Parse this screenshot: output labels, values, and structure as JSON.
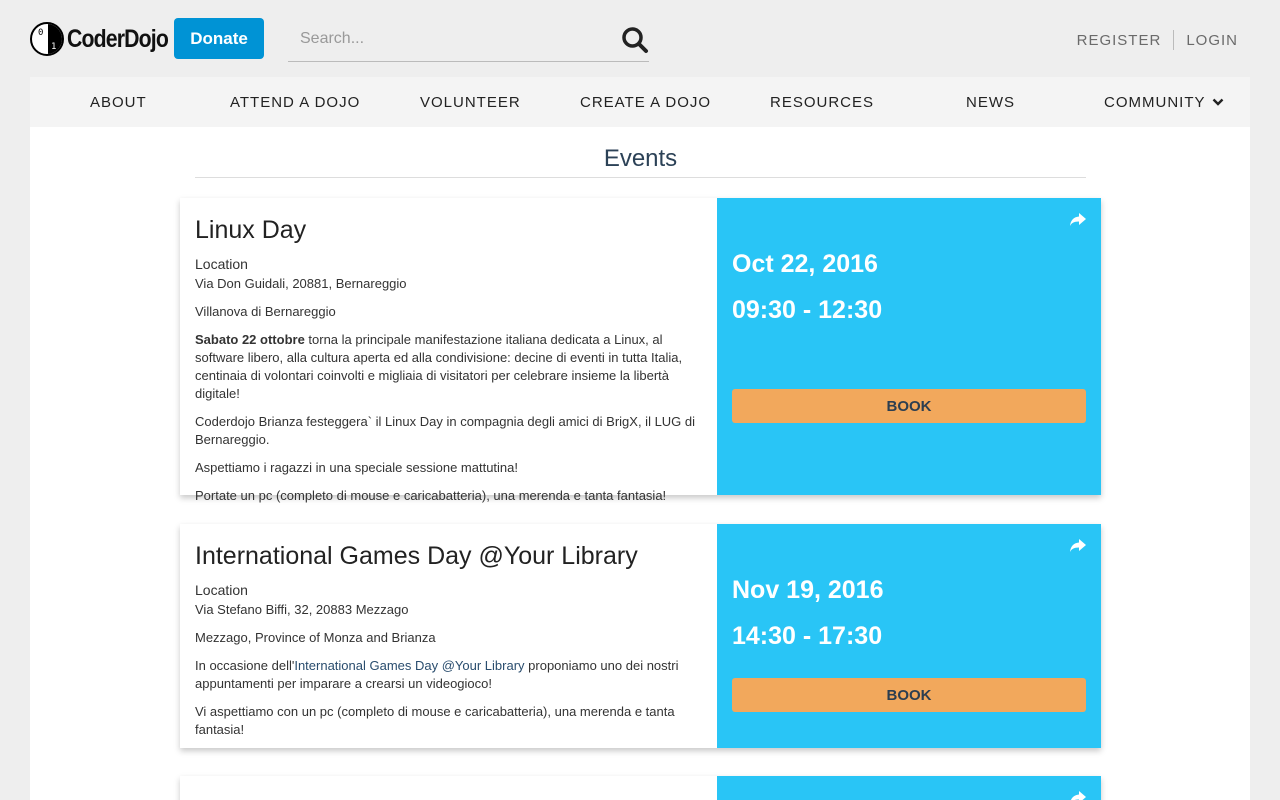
{
  "header": {
    "logo_text": "CoderDojo",
    "donate_label": "Donate",
    "search_placeholder": "Search...",
    "register_label": "REGISTER",
    "login_label": "LOGIN"
  },
  "nav": {
    "items": [
      {
        "label": "ABOUT"
      },
      {
        "label": "ATTEND A DOJO"
      },
      {
        "label": "VOLUNTEER"
      },
      {
        "label": "CREATE A DOJO"
      },
      {
        "label": "RESOURCES"
      },
      {
        "label": "NEWS"
      },
      {
        "label": "COMMUNITY"
      }
    ]
  },
  "page_title": "Events",
  "events": [
    {
      "title": "Linux Day",
      "location_label": "Location",
      "address": "Via Don Guidali, 20881, Bernareggio",
      "city": "Villanova di Bernareggio",
      "p1_bold": "Sabato 22 ottobre",
      "p1_rest": " torna la principale manifestazione italiana dedicata a Linux, al software libero, alla cultura aperta ed alla condivisione: decine di eventi in tutta Italia, centinaia di volontari coinvolti e migliaia di visitatori per celebrare insieme la libertà digitale!",
      "p2": "Coderdojo Brianza festeggera` il Linux Day in compagnia degli amici di BrigX, il LUG di Bernareggio.",
      "p3": "Aspettiamo i ragazzi in una speciale sessione mattutina!",
      "p4": "Portate un pc (completo di mouse e caricabatteria), una merenda e tanta fantasia!",
      "date": "Oct 22, 2016",
      "time": "09:30 - 12:30",
      "book_label": "BOOK"
    },
    {
      "title": "International Games Day @Your Library",
      "location_label": "Location",
      "address": "Via Stefano Biffi, 32, 20883 Mezzago",
      "city": "Mezzago, Province of Monza and Brianza",
      "p1_pre": "In occasione dell'",
      "p1_link": "International Games Day @Your Library",
      "p1_rest": "   proponiamo uno dei nostri appuntamenti per imparare a crearsi un videogioco!",
      "p2": "Vi aspettiamo con un pc (completo di mouse e caricabatteria), una merenda e tanta fantasia!",
      "date": "Nov 19, 2016",
      "time": "14:30 - 17:30",
      "book_label": "BOOK"
    }
  ],
  "colors": {
    "donate": "#0093d5",
    "event_panel": "#29c5f6",
    "book_button": "#f2a85c",
    "title": "#2c4257"
  },
  "icons": {
    "search": "search-icon",
    "share": "share-icon",
    "chevron": "chevron-down-icon"
  }
}
